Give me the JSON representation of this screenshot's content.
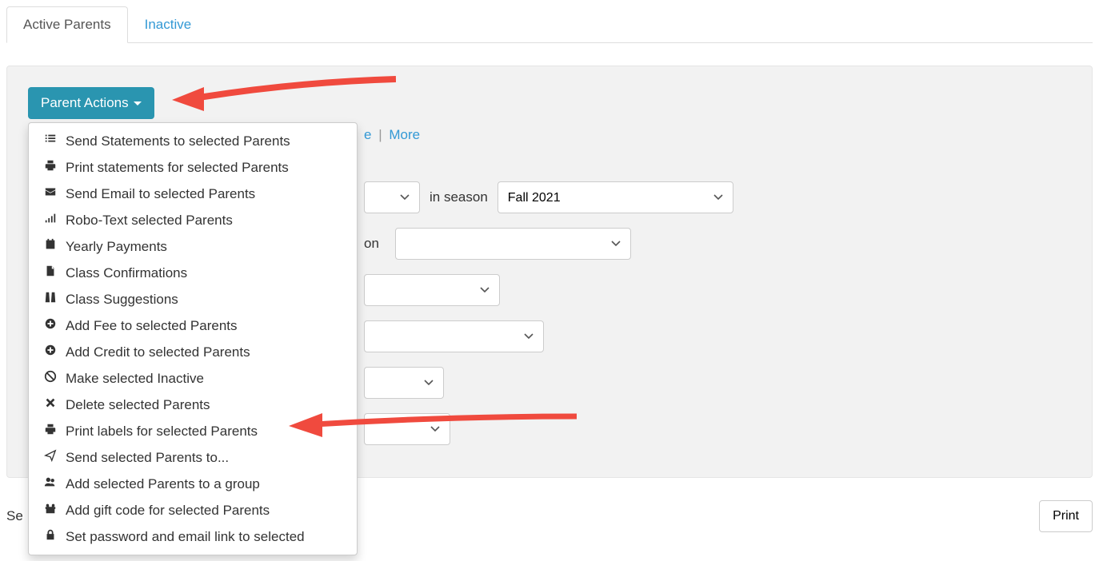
{
  "tabs": {
    "active": "Active Parents",
    "inactive": "Inactive"
  },
  "parent_actions": {
    "button_label": "Parent Actions",
    "items": [
      {
        "icon": "list",
        "label": "Send Statements to selected Parents"
      },
      {
        "icon": "print",
        "label": "Print statements for selected Parents"
      },
      {
        "icon": "envelope",
        "label": "Send Email to selected Parents"
      },
      {
        "icon": "signal",
        "label": "Robo-Text selected Parents"
      },
      {
        "icon": "calendar",
        "label": "Yearly Payments"
      },
      {
        "icon": "file",
        "label": "Class Confirmations"
      },
      {
        "icon": "road",
        "label": "Class Suggestions"
      },
      {
        "icon": "plus-circle",
        "label": "Add Fee to selected Parents"
      },
      {
        "icon": "plus-circle",
        "label": "Add Credit to selected Parents"
      },
      {
        "icon": "ban",
        "label": "Make selected Inactive"
      },
      {
        "icon": "times",
        "label": "Delete selected Parents"
      },
      {
        "icon": "print",
        "label": "Print labels for selected Parents"
      },
      {
        "icon": "send",
        "label": "Send selected Parents to..."
      },
      {
        "icon": "users",
        "label": "Add selected Parents to a group"
      },
      {
        "icon": "gift",
        "label": "Add gift code for selected Parents"
      },
      {
        "icon": "lock",
        "label": "Set password and email link to selected"
      }
    ]
  },
  "filter_links": {
    "partial_e": "e",
    "more": "More"
  },
  "filters": {
    "in_season_label": "in season",
    "season_value": "Fall 2021",
    "on_suffix": "on"
  },
  "bottom": {
    "left_partial": "Se",
    "print": "Print"
  }
}
